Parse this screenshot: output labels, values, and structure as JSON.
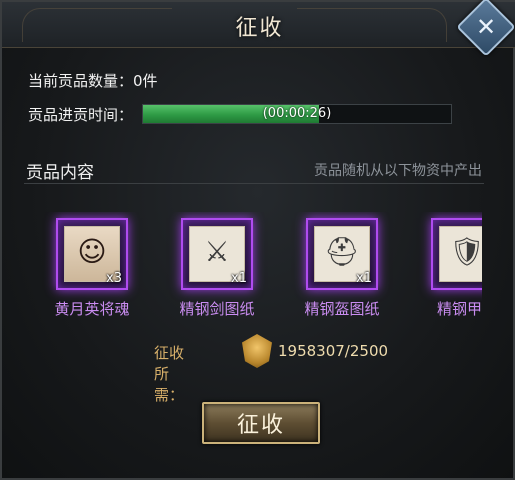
{
  "window": {
    "title": "征收",
    "close_icon": "close-x-icon"
  },
  "tribute": {
    "count_label": "当前贡品数量：0件",
    "time_label": "贡品进贡时间：",
    "progress_text": "(00:00:26)",
    "progress_fraction": 0.57
  },
  "contents": {
    "title": "贡品内容",
    "note": "贡品随机从以下物资中产出",
    "items": [
      {
        "name": "黄月英将魂",
        "qty": "x3",
        "icon": "hero-portrait-icon"
      },
      {
        "name": "精钢剑图纸",
        "qty": "x1",
        "icon": "sword-scroll-icon"
      },
      {
        "name": "精钢盔图纸",
        "qty": "x1",
        "icon": "helmet-scroll-icon"
      },
      {
        "name": "精钢甲图",
        "qty": "",
        "icon": "armor-scroll-icon"
      }
    ]
  },
  "cost": {
    "label": "征收所需：",
    "value": "1958307/2500",
    "icon": "gold-medal-icon"
  },
  "actions": {
    "collect_label": "征收"
  },
  "colors": {
    "rarity_purple": "#b04cf0",
    "progress_green": "#2e9a45",
    "gold": "#d8b06a"
  }
}
